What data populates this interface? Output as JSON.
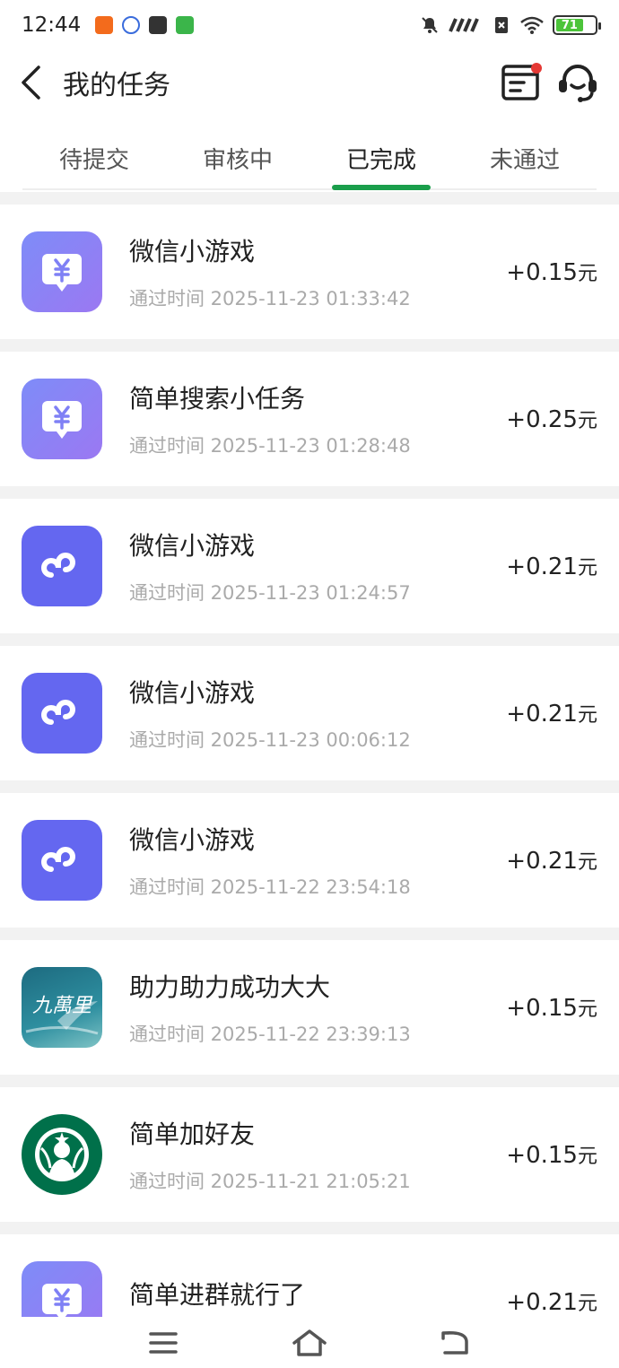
{
  "status_bar": {
    "time": "12:44",
    "battery_level": "71",
    "battery_fraction": 0.71,
    "app_icons": [
      "taobao-icon",
      "baidu-icon",
      "mail-icon",
      "app-icon"
    ],
    "indicators": [
      "mute-icon",
      "signal-icon",
      "sim-off-icon",
      "wifi-icon"
    ]
  },
  "header": {
    "title": "我的任务",
    "back_icon": "chevron-left-icon",
    "list_icon": "task-list-icon",
    "support_icon": "headset-icon",
    "notification_color": "#e53935"
  },
  "tabs": [
    {
      "label": "待提交",
      "active": false
    },
    {
      "label": "审核中",
      "active": false
    },
    {
      "label": "已完成",
      "active": true
    },
    {
      "label": "未通过",
      "active": false
    }
  ],
  "accent_color": "#1a9e4b",
  "tasks": [
    {
      "name": "微信小游戏",
      "time": "通过时间 2025-11-23 01:33:42",
      "amount": "+0.15",
      "unit": "元",
      "icon": "yuan-chat-icon"
    },
    {
      "name": "简单搜索小任务",
      "time": "通过时间 2025-11-23 01:28:48",
      "amount": "+0.25",
      "unit": "元",
      "icon": "yuan-chat-icon"
    },
    {
      "name": "微信小游戏",
      "time": "通过时间 2025-11-23 01:24:57",
      "amount": "+0.21",
      "unit": "元",
      "icon": "mini-program-icon"
    },
    {
      "name": "微信小游戏",
      "time": "通过时间 2025-11-23 00:06:12",
      "amount": "+0.21",
      "unit": "元",
      "icon": "mini-program-icon"
    },
    {
      "name": "微信小游戏",
      "time": "通过时间 2025-11-22 23:54:18",
      "amount": "+0.21",
      "unit": "元",
      "icon": "mini-program-icon"
    },
    {
      "name": "助力助力成功大大",
      "time": "通过时间 2025-11-22 23:39:13",
      "amount": "+0.15",
      "unit": "元",
      "icon": "brand-logo-icon",
      "logo_text": "九萬里"
    },
    {
      "name": "简单加好友",
      "time": "通过时间 2025-11-21 21:05:21",
      "amount": "+0.15",
      "unit": "元",
      "icon": "starbucks-logo-icon"
    },
    {
      "name": "简单进群就行了",
      "time": "",
      "amount": "+0.21",
      "unit": "元",
      "icon": "yuan-chat-icon"
    }
  ],
  "nav_bar": {
    "buttons": [
      "menu-icon",
      "home-icon",
      "back-icon"
    ]
  }
}
